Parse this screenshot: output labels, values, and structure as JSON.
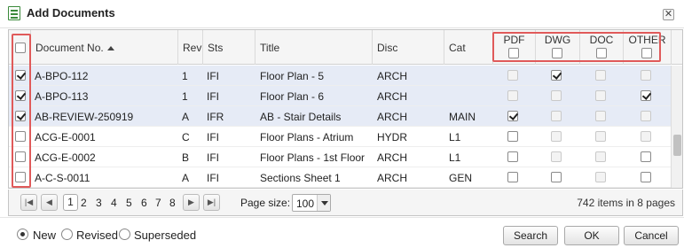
{
  "dialog": {
    "title": "Add Documents",
    "close_glyph": "✕"
  },
  "columns": {
    "doc_no": "Document No.",
    "rev": "Rev",
    "sts": "Sts",
    "title": "Title",
    "disc": "Disc",
    "cat": "Cat",
    "pdf": "PDF",
    "dwg": "DWG",
    "doc": "DOC",
    "other": "OTHER"
  },
  "rows": [
    {
      "selected": true,
      "doc_no": "A-BPO-112",
      "rev": "1",
      "sts": "IFI",
      "title": "Floor Plan - 5",
      "disc": "ARCH",
      "cat": "",
      "pdf": {
        "checked": false,
        "enabled": false
      },
      "dwg": {
        "checked": true,
        "enabled": true
      },
      "doc": {
        "checked": false,
        "enabled": false
      },
      "other": {
        "checked": false,
        "enabled": false
      }
    },
    {
      "selected": true,
      "doc_no": "A-BPO-113",
      "rev": "1",
      "sts": "IFI",
      "title": "Floor Plan - 6",
      "disc": "ARCH",
      "cat": "",
      "pdf": {
        "checked": false,
        "enabled": false
      },
      "dwg": {
        "checked": false,
        "enabled": false
      },
      "doc": {
        "checked": false,
        "enabled": false
      },
      "other": {
        "checked": true,
        "enabled": true
      }
    },
    {
      "selected": true,
      "doc_no": "AB-REVIEW-250919",
      "rev": "A",
      "sts": "IFR",
      "title": "AB - Stair Details",
      "disc": "ARCH",
      "cat": "MAIN",
      "pdf": {
        "checked": true,
        "enabled": true
      },
      "dwg": {
        "checked": false,
        "enabled": false
      },
      "doc": {
        "checked": false,
        "enabled": false
      },
      "other": {
        "checked": false,
        "enabled": false
      }
    },
    {
      "selected": false,
      "doc_no": "ACG-E-0001",
      "rev": "C",
      "sts": "IFI",
      "title": "Floor Plans - Atrium",
      "disc": "HYDR",
      "cat": "L1",
      "pdf": {
        "checked": false,
        "enabled": true
      },
      "dwg": {
        "checked": false,
        "enabled": false
      },
      "doc": {
        "checked": false,
        "enabled": false
      },
      "other": {
        "checked": false,
        "enabled": false
      }
    },
    {
      "selected": false,
      "doc_no": "ACG-E-0002",
      "rev": "B",
      "sts": "IFI",
      "title": "Floor Plans - 1st Floor",
      "disc": "ARCH",
      "cat": "L1",
      "pdf": {
        "checked": false,
        "enabled": true
      },
      "dwg": {
        "checked": false,
        "enabled": false
      },
      "doc": {
        "checked": false,
        "enabled": false
      },
      "other": {
        "checked": false,
        "enabled": true
      }
    },
    {
      "selected": false,
      "doc_no": "A-C-S-0011",
      "rev": "A",
      "sts": "IFI",
      "title": "Sections Sheet 1",
      "disc": "ARCH",
      "cat": "GEN",
      "pdf": {
        "checked": false,
        "enabled": true
      },
      "dwg": {
        "checked": false,
        "enabled": true
      },
      "doc": {
        "checked": false,
        "enabled": false
      },
      "other": {
        "checked": false,
        "enabled": true
      }
    }
  ],
  "pager": {
    "first": "|◀",
    "prev": "◀",
    "next": "▶",
    "last": "▶|",
    "pages": [
      "1",
      "2",
      "3",
      "4",
      "5",
      "6",
      "7",
      "8"
    ],
    "current_page": "1",
    "page_size_label": "Page size:",
    "page_size": "100",
    "info": "742 items in 8 pages"
  },
  "footer": {
    "radio_options": [
      "New",
      "Revised",
      "Superseded"
    ],
    "selected_radio": "New",
    "search_label": "Search",
    "ok_label": "OK",
    "cancel_label": "Cancel"
  },
  "colors": {
    "selected_row": "#e6ebf6",
    "highlight_box": "#e05a5a",
    "header_bg": "#f5f5f5"
  }
}
